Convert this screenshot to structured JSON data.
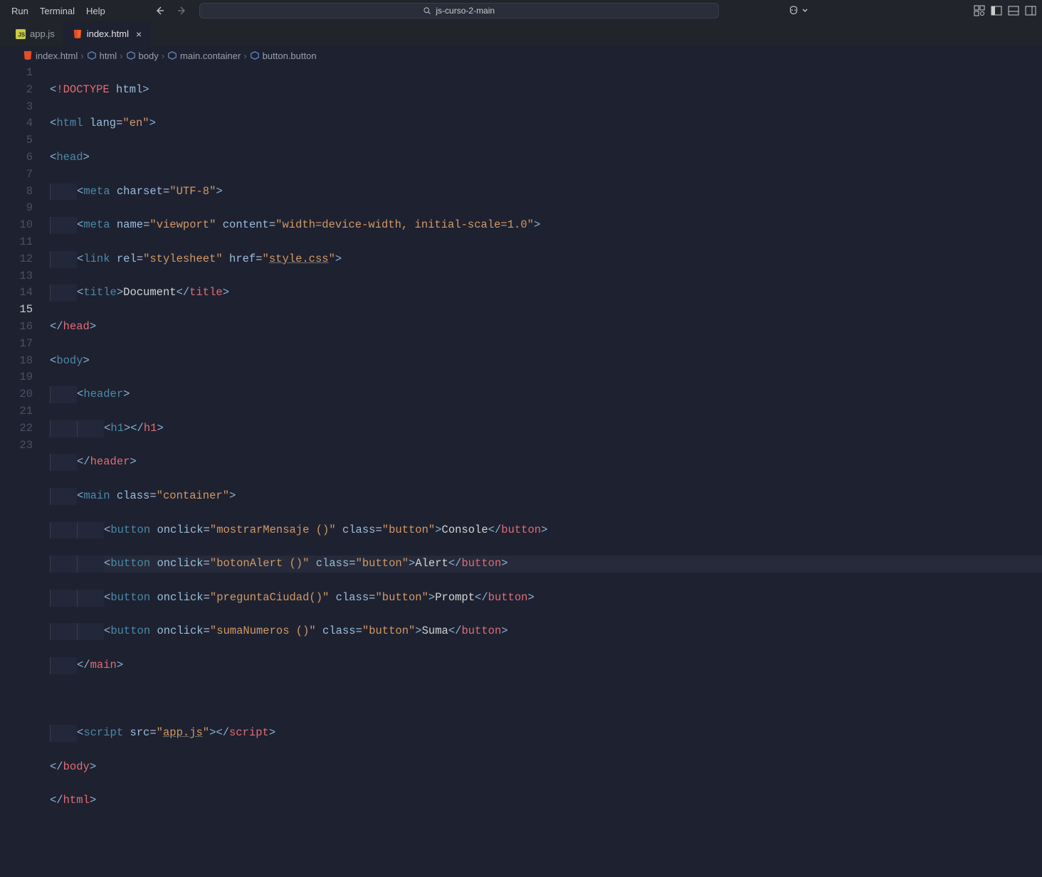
{
  "menu": {
    "run": "Run",
    "terminal": "Terminal",
    "help": "Help"
  },
  "search": {
    "text": "js-curso-2-main"
  },
  "tabs": {
    "appjs": "app.js",
    "indexhtml": "index.html"
  },
  "breadcrumb": {
    "file": "index.html",
    "html": "html",
    "body": "body",
    "main": "main.container",
    "button": "button.button"
  },
  "code": {
    "l1_doctype": "!DOCTYPE",
    "l1_html": "html",
    "l2_html": "html",
    "l2_lang": "lang",
    "l2_lang_v": "en",
    "l3_head": "head",
    "l4_meta": "meta",
    "l4_charset": "charset",
    "l4_charset_v": "UTF-8",
    "l5_meta": "meta",
    "l5_name": "name",
    "l5_name_v": "viewport",
    "l5_content": "content",
    "l5_content_v": "width=device-width, initial-scale=1.0",
    "l6_link": "link",
    "l6_rel": "rel",
    "l6_rel_v": "stylesheet",
    "l6_href": "href",
    "l6_href_v": "style.css",
    "l7_title": "title",
    "l7_title_text": "Document",
    "l8_head": "head",
    "l9_body": "body",
    "l10_header": "header",
    "l11_h1": "h1",
    "l12_header": "header",
    "l13_main": "main",
    "l13_class": "class",
    "l13_class_v": "container",
    "l14_button": "button",
    "l14_onclick": "onclick",
    "l14_onclick_v": "mostrarMensaje ()",
    "l14_class": "class",
    "l14_class_v": "button",
    "l14_text": "Console",
    "l15_button": "button",
    "l15_onclick": "onclick",
    "l15_onclick_v": "botonAlert ()",
    "l15_class": "class",
    "l15_class_v": "button",
    "l15_text": "Alert",
    "l16_button": "button",
    "l16_onclick": "onclick",
    "l16_onclick_v": "preguntaCiudad()",
    "l16_class": "class",
    "l16_class_v": "button",
    "l16_text": "Prompt",
    "l17_button": "button",
    "l17_onclick": "onclick",
    "l17_onclick_v": "sumaNumeros ()",
    "l17_class": "class",
    "l17_class_v": "button",
    "l17_text": "Suma",
    "l18_main": "main",
    "l20_script": "script",
    "l20_src": "src",
    "l20_src_v": "app.js",
    "l21_body": "body",
    "l22_html": "html"
  },
  "lineNumbers": [
    "1",
    "2",
    "3",
    "4",
    "5",
    "6",
    "7",
    "8",
    "9",
    "10",
    "11",
    "12",
    "13",
    "14",
    "15",
    "16",
    "17",
    "18",
    "19",
    "20",
    "21",
    "22",
    "23"
  ],
  "activeLine": 15
}
